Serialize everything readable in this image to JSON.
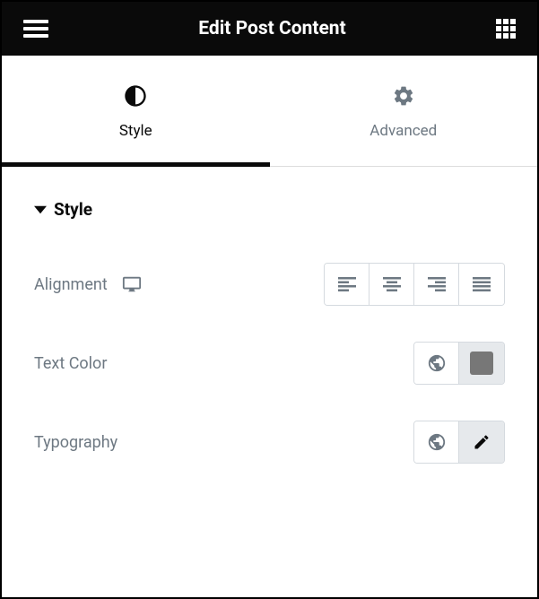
{
  "header": {
    "title": "Edit Post Content"
  },
  "tabs": [
    {
      "label": "Style",
      "active": true
    },
    {
      "label": "Advanced",
      "active": false
    }
  ],
  "section": {
    "title": "Style"
  },
  "controls": {
    "alignment": {
      "label": "Alignment"
    },
    "text_color": {
      "label": "Text Color"
    },
    "typography": {
      "label": "Typography"
    }
  }
}
